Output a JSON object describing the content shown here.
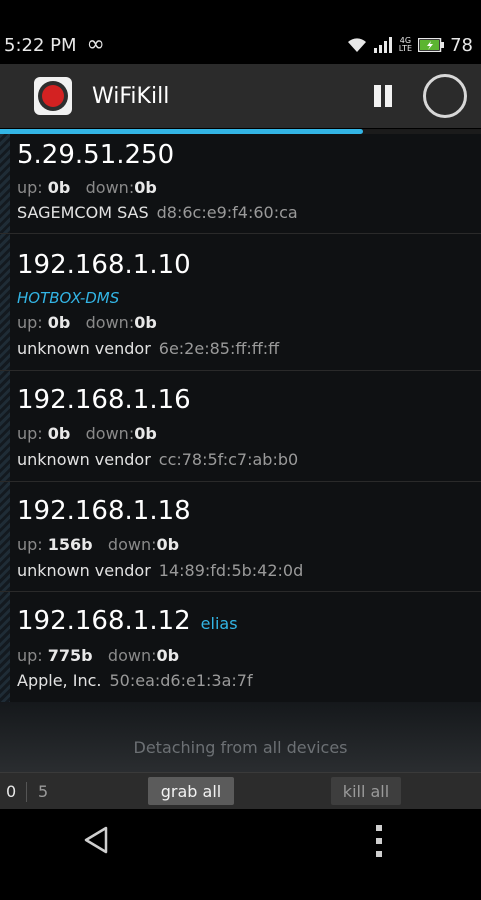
{
  "status_bar": {
    "time": "5:22 PM",
    "infinity": "∞",
    "net_badge_top": "4G",
    "net_badge_bottom": "LTE",
    "battery": "78",
    "icons": [
      "infinity-icon",
      "wifi-icon",
      "signal-icon",
      "battery-charging-icon"
    ]
  },
  "action_bar": {
    "title": "WiFiKill",
    "icons": [
      "app-icon",
      "pause-icon",
      "refresh-icon"
    ]
  },
  "scan_progress": 0.755,
  "devices": [
    {
      "ip": "5.29.51.250",
      "up_label": "up:",
      "up": "0b",
      "down_label": "down:",
      "down": "0b",
      "vendor": "SAGEMCOM SAS",
      "mac": "d8:6c:e9:f4:60:ca"
    },
    {
      "ip": "192.168.1.10",
      "host": "HOTBOX-DMS",
      "up_label": "up:",
      "up": "0b",
      "down_label": "down:",
      "down": "0b",
      "vendor": "unknown vendor",
      "mac": "6e:2e:85:ff:ff:ff"
    },
    {
      "ip": "192.168.1.16",
      "up_label": "up:",
      "up": "0b",
      "down_label": "down:",
      "down": "0b",
      "vendor": "unknown vendor",
      "mac": "cc:78:5f:c7:ab:b0"
    },
    {
      "ip": "192.168.1.18",
      "up_label": "up:",
      "up": "156b",
      "down_label": "down:",
      "down": "0b",
      "vendor": "unknown vendor",
      "mac": "14:89:fd:5b:42:0d"
    },
    {
      "ip": "192.168.1.12",
      "alias": "elias",
      "up_label": "up:",
      "up": "775b",
      "down_label": "down:",
      "down": "0b",
      "vendor": "Apple, Inc.",
      "mac": "50:ea:d6:e1:3a:7f"
    }
  ],
  "detach_message": "Detaching from all devices",
  "bottom_bar": {
    "killed_count": "0",
    "total_count": "5",
    "grab_all": "grab all",
    "kill_all": "kill all"
  },
  "nav_bar": {
    "icons": [
      "back-icon",
      "menu-icon"
    ]
  },
  "colors": {
    "accent": "#33b5e5",
    "action_bar": "#2b2b2b",
    "list_bg": "#0f1113"
  }
}
